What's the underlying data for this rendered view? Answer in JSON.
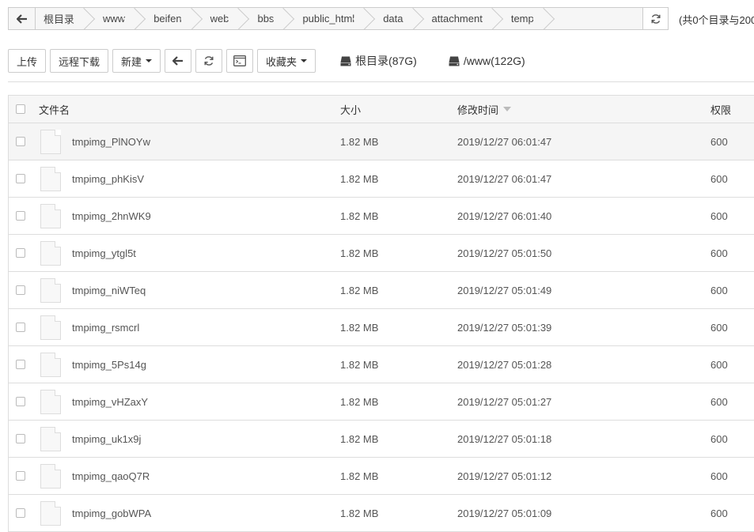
{
  "breadcrumb": {
    "items": [
      "根目录",
      "www",
      "beifen",
      "web",
      "bbs",
      "public_html",
      "data",
      "attachment",
      "temp"
    ],
    "summary": "(共0个目录与200"
  },
  "toolbar": {
    "upload": "上传",
    "remote_download": "远程下载",
    "new": "新建",
    "favorites": "收藏夹",
    "disks": [
      {
        "label": "根目录(87G)"
      },
      {
        "label": "/www(122G)"
      }
    ]
  },
  "table": {
    "headers": {
      "name": "文件名",
      "size": "大小",
      "modified": "修改时间",
      "perm": "权限"
    },
    "rows": [
      {
        "name": "tmpimg_PlNOYw",
        "size": "1.82 MB",
        "modified": "2019/12/27 06:01:47",
        "perm": "600"
      },
      {
        "name": "tmpimg_phKisV",
        "size": "1.82 MB",
        "modified": "2019/12/27 06:01:47",
        "perm": "600"
      },
      {
        "name": "tmpimg_2hnWK9",
        "size": "1.82 MB",
        "modified": "2019/12/27 06:01:40",
        "perm": "600"
      },
      {
        "name": "tmpimg_ytgl5t",
        "size": "1.82 MB",
        "modified": "2019/12/27 05:01:50",
        "perm": "600"
      },
      {
        "name": "tmpimg_niWTeq",
        "size": "1.82 MB",
        "modified": "2019/12/27 05:01:49",
        "perm": "600"
      },
      {
        "name": "tmpimg_rsmcrl",
        "size": "1.82 MB",
        "modified": "2019/12/27 05:01:39",
        "perm": "600"
      },
      {
        "name": "tmpimg_5Ps14g",
        "size": "1.82 MB",
        "modified": "2019/12/27 05:01:28",
        "perm": "600"
      },
      {
        "name": "tmpimg_vHZaxY",
        "size": "1.82 MB",
        "modified": "2019/12/27 05:01:27",
        "perm": "600"
      },
      {
        "name": "tmpimg_uk1x9j",
        "size": "1.82 MB",
        "modified": "2019/12/27 05:01:18",
        "perm": "600"
      },
      {
        "name": "tmpimg_qaoQ7R",
        "size": "1.82 MB",
        "modified": "2019/12/27 05:01:12",
        "perm": "600"
      },
      {
        "name": "tmpimg_gobWPA",
        "size": "1.82 MB",
        "modified": "2019/12/27 05:01:09",
        "perm": "600"
      }
    ]
  }
}
